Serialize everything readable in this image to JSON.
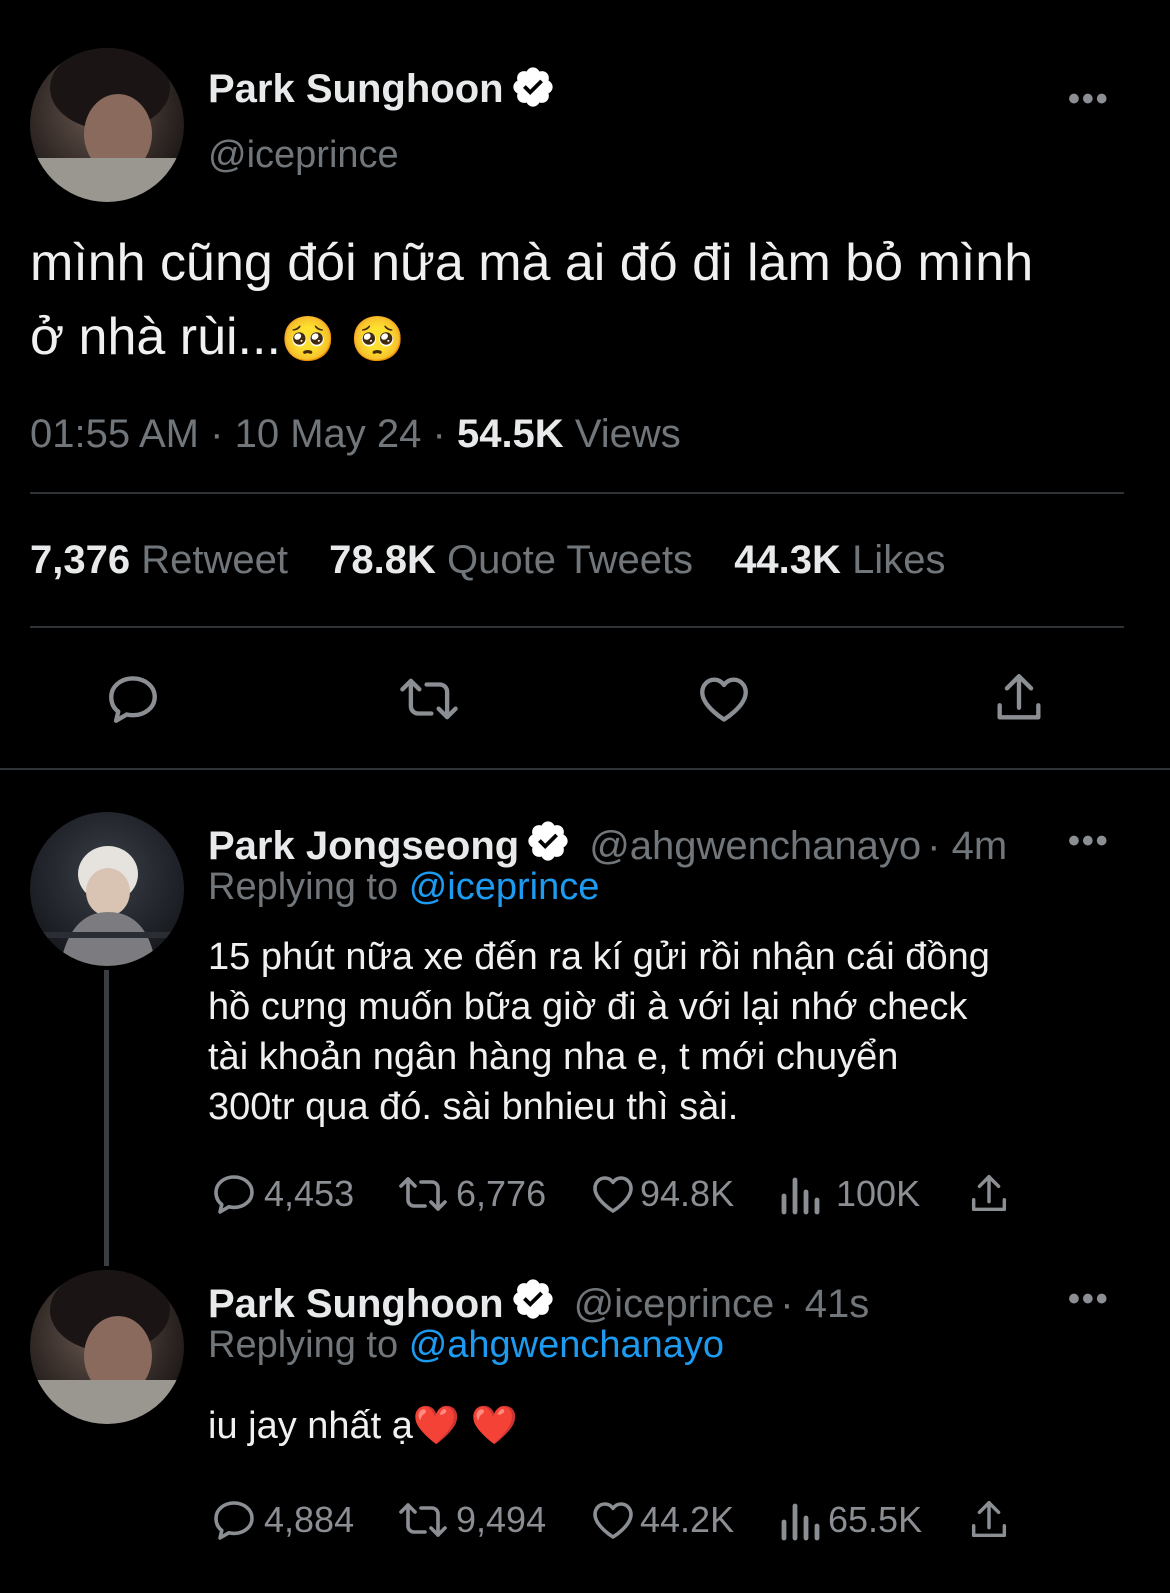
{
  "main_tweet": {
    "author_name": "Park Sunghoon",
    "handle": "@iceprince",
    "text_line1": "mình cũng đói nữa mà ai đó đi làm bỏ mình",
    "text_line2": "ở nhà rùi...",
    "emoji": "🥺",
    "time": "01:55 AM",
    "sep": "·",
    "date": "10 May 24",
    "views_count": "54.5K",
    "views_label": "Views",
    "retweet_count": "7,376",
    "retweet_label": "Retweet",
    "quote_count": "78.8K",
    "quote_label": "Quote Tweets",
    "likes_count": "44.3K",
    "likes_label": "Likes",
    "more": "•••"
  },
  "reply1": {
    "author_name": "Park Jongseong",
    "handle": "@ahgwenchanayo",
    "age": "· 4m",
    "replying_label": "Replying to",
    "replying_handle": "@iceprince",
    "lines": [
      "15 phút nữa xe đến ra kí gửi rồi nhận cái đồng",
      "hồ cưng muốn bữa giờ đi à với lại nhớ check",
      "tài khoản ngân hàng nha e, t mới chuyển",
      "300tr qua đó. sài bnhieu thì sài."
    ],
    "replies": "4,453",
    "retweets": "6,776",
    "likes": "94.8K",
    "views": "100K",
    "more": "•••"
  },
  "reply2": {
    "author_name": "Park Sunghoon",
    "handle": "@iceprince",
    "age": "· 41s",
    "replying_label": "Replying to",
    "replying_handle": "@ahgwenchanayo",
    "text": "iu jay nhất ạ",
    "emoji": "❤️",
    "replies": "4,884",
    "retweets": "9,494",
    "likes": "44.2K",
    "views": "65.5K",
    "more": "•••"
  },
  "icons": [
    "verified-badge-icon",
    "reply-icon",
    "retweet-icon",
    "like-icon",
    "share-icon",
    "views-icon",
    "more-icon"
  ],
  "colors": {
    "background": "#000000",
    "text": "#e7e9ea",
    "muted": "#71767b",
    "link": "#1d9bf0",
    "divider": "#2f3336"
  }
}
